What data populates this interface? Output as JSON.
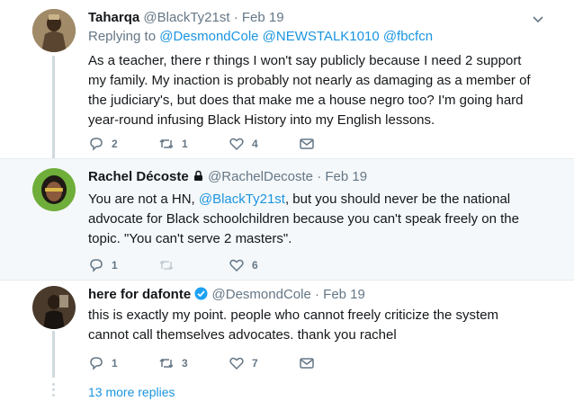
{
  "tweets": [
    {
      "name": "Taharqa",
      "handle": "@BlackTy21st",
      "dot": "·",
      "date": "Feb 19",
      "reply_prefix": "Replying to",
      "reply_to": "@DesmondCole @NEWSTALK1010 @fbcfcn",
      "text": "As a teacher, there r things I won't say publicly because I need 2 support my family. My inaction is probably not nearly as damaging as a member of the judiciary's, but does that make me a house negro too? I'm going hard year-round infusing Black History into my English lessons.",
      "replies": "2",
      "retweets": "1",
      "likes": "4"
    },
    {
      "name": "Rachel Décoste",
      "handle": "@RachelDecoste",
      "dot": "·",
      "date": "Feb 19",
      "text_part1": "You are not a HN, ",
      "text_mention": "@BlackTy21st",
      "text_part2": ", but you should never be the national advocate for Black schoolchildren because you can't speak freely on the topic.  \"You can't serve 2 masters\".",
      "replies": "1",
      "retweets": "",
      "likes": "6"
    },
    {
      "name": "here for dafonte",
      "handle": "@DesmondCole",
      "dot": "·",
      "date": "Feb 19",
      "text": "this is exactly my point. people who cannot freely criticize the system cannot call themselves advocates. thank you rachel",
      "replies": "1",
      "retweets": "3",
      "likes": "7"
    }
  ],
  "more_replies": "13 more replies",
  "colors": {
    "link": "#1b95e0",
    "meta": "#657786",
    "verified": "#1da1f2",
    "highlight_bg": "#f5f8fa"
  }
}
